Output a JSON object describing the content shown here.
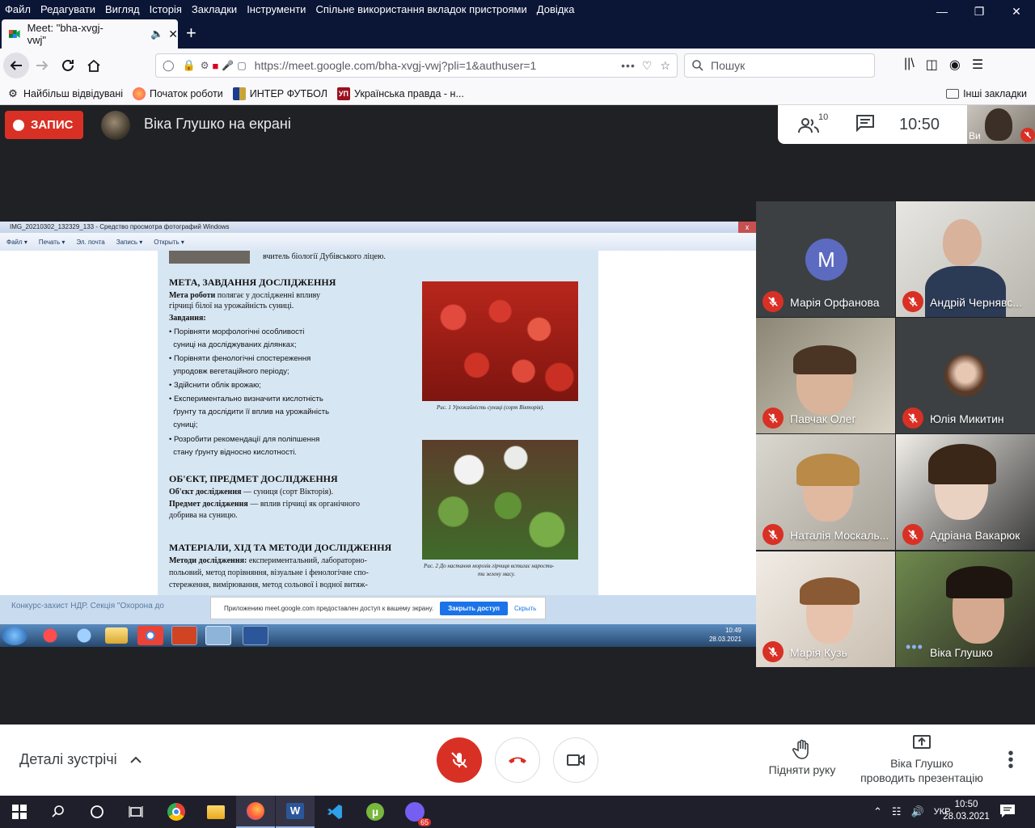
{
  "browser": {
    "menu": [
      "Файл",
      "Редагувати",
      "Вигляд",
      "Історія",
      "Закладки",
      "Інструменти",
      "Спільне використання вкладок пристроями",
      "Довідка"
    ],
    "tab_title": "Meet: \"bha-xvgj-vwj\"",
    "url": "https://meet.google.com/bha-xvgj-vwj?pli=1&authuser=1",
    "url_domain": "meet.google.com",
    "search_placeholder": "Пошук",
    "bookmarks": [
      "Найбільш відвідувані",
      "Початок роботи",
      "ИНТЕР ФУТБОЛ",
      "Українська правда - н..."
    ],
    "other_bookmarks": "Інші закладки"
  },
  "meet": {
    "rec_label": "ЗАПИС",
    "presenter_title": "Віка Глушко на екрані",
    "participants_count": "10",
    "time": "10:50",
    "self_label": "Ви",
    "participants": [
      {
        "name": "Марія Орфанова",
        "initial": "M",
        "muted": true
      },
      {
        "name": "Андрій Чернявс...",
        "muted": true
      },
      {
        "name": "Павчак Олег",
        "muted": true
      },
      {
        "name": "Юлія Микитин",
        "muted": true
      },
      {
        "name": "Наталія Москаль...",
        "muted": true
      },
      {
        "name": "Адріана Вакарюк",
        "muted": true
      },
      {
        "name": "Марія Кузь",
        "muted": true
      },
      {
        "name": "Віка Глушко",
        "muted": false
      }
    ],
    "details_label": "Деталі зустрічі",
    "raise_hand_label": "Підняти руку",
    "presenting_line1": "Віка Глушко",
    "presenting_line2": "проводить презентацію"
  },
  "shared_screen": {
    "viewer_title": "IMG_20210302_132329_133 - Средство просмотра фотографий Windows",
    "viewer_menu": [
      "Файл ▾",
      "Печать ▾",
      "Эл. почта",
      "Запись ▾",
      "Открыть ▾"
    ],
    "doc": {
      "top_line": "вчитель біології Дубівського ліцею.",
      "h1": "МЕТА, ЗАВДАННЯ ДОСЛІДЖЕННЯ",
      "aim_bold": "Мета роботи",
      "aim_rest": " полягає у дослідженні впливу",
      "aim_line2": "гірчиці білої на урожайність суниці.",
      "tasks_label": "Завдання:",
      "tasks": [
        "• Порівняти морфологічні особливості",
        "  суниці на досліджуваних ділянках;",
        "• Порівняти фенологічні спостереження",
        "  упродовж вегетаційного періоду;",
        "• Здійснити облік врожаю;",
        "• Експериментально визначити кислотність",
        "  ґрунту та дослідити її вплив на урожайність",
        "  суниці;",
        "• Розробити рекомендації для поліпшення",
        "  стану ґрунту відносно кислотності."
      ],
      "h2": "ОБ'ЄКТ, ПРЕДМЕТ ДОСЛІДЖЕННЯ",
      "object_bold": "Об'єкт дослідження",
      "object_rest": " — суниця (сорт Вікторія).",
      "subject_bold": "Предмет дослідження",
      "subject_rest": " — вплив гірчиці як органічного",
      "subject_line2": "добрива на суницю.",
      "h3": "МАТЕРІАЛИ, ХІД ТА МЕТОДИ ДОСЛІДЖЕННЯ",
      "methods_bold": "Методи дослідження:",
      "methods_rest": " експериментальний, лабораторно-",
      "methods_line2": "польовий, метод порівняння, візуальне і фенологічне спо-",
      "methods_line3": "стереження, вимірювання, метод сольової і водної витяж-",
      "caption1": "Рис. 1 Урожайність суниці (сорт Вікторія).",
      "caption2a": "Рис. 2 До настання морозів гірчиця встигає нарости-",
      "caption2b": "ти зелену масу."
    },
    "slide_footer": "Конкурс-захист НДР. Секція \"Охорона до",
    "share_notice": "Приложению meet.google.com предоставлен доступ к вашему экрану.",
    "share_button": "Закрыть доступ",
    "share_hide": "Скрыть",
    "win7_time": "10:49",
    "win7_date": "28.03.2021"
  },
  "taskbar": {
    "lang": "УКР",
    "time": "10:50",
    "date": "28.03.2021",
    "viber_badge": "65"
  }
}
